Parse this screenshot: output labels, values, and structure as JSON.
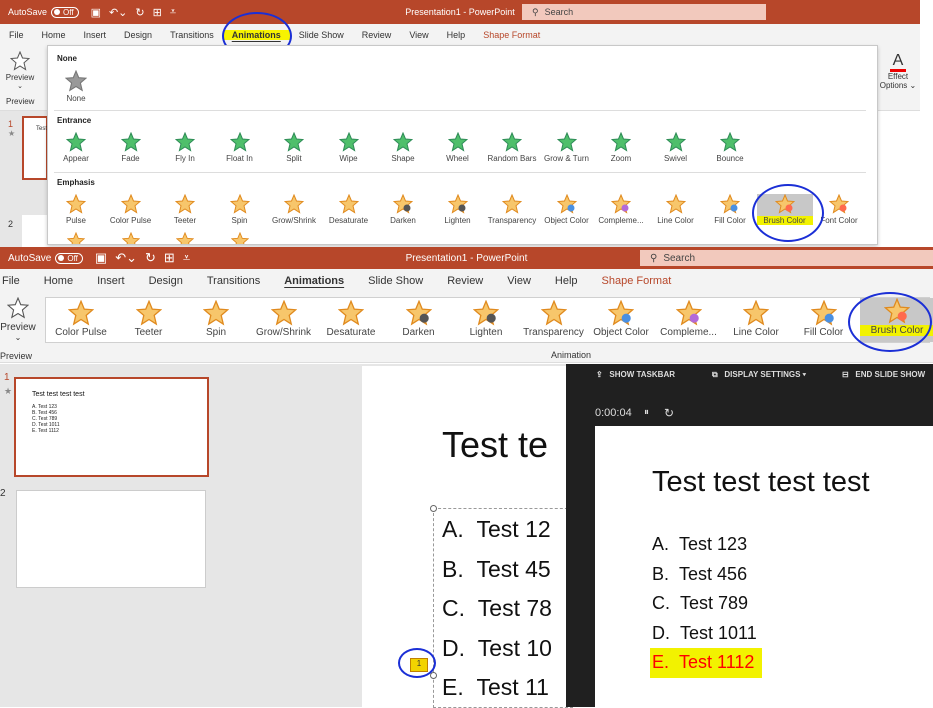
{
  "top": {
    "autosave_label": "AutoSave",
    "autosave_state": "Off",
    "title": "Presentation1 - PowerPoint",
    "search_placeholder": "Search",
    "menu": [
      "File",
      "Home",
      "Insert",
      "Design",
      "Transitions",
      "Animations",
      "Slide Show",
      "Review",
      "View",
      "Help",
      "Shape Format"
    ],
    "active_tab": "Animations",
    "preview_label": "Preview",
    "preview_group": "Preview",
    "effect_options_1": "Effect",
    "effect_options_2": "Options",
    "slide_numbers": [
      "1",
      "2"
    ],
    "thumb_title": "Test",
    "sections": {
      "none": "None",
      "entrance": "Entrance",
      "emphasis": "Emphasis"
    },
    "none_item": "None",
    "entrance_items": [
      "Appear",
      "Fade",
      "Fly In",
      "Float In",
      "Split",
      "Wipe",
      "Shape",
      "Wheel",
      "Random Bars",
      "Grow & Turn",
      "Zoom",
      "Swivel",
      "Bounce"
    ],
    "emphasis_items": [
      "Pulse",
      "Color Pulse",
      "Teeter",
      "Spin",
      "Grow/Shrink",
      "Desaturate",
      "Darken",
      "Lighten",
      "Transparency",
      "Object Color",
      "Compleme...",
      "Line Color",
      "Fill Color",
      "Brush Color",
      "Font Color"
    ]
  },
  "bottom": {
    "autosave_label": "AutoSave",
    "autosave_state": "Off",
    "title": "Presentation1 - PowerPoint",
    "search_placeholder": "Search",
    "menu": [
      "File",
      "Home",
      "Insert",
      "Design",
      "Transitions",
      "Animations",
      "Slide Show",
      "Review",
      "View",
      "Help",
      "Shape Format"
    ],
    "preview_label": "Preview",
    "preview_group": "Preview",
    "animation_group": "Animation",
    "items": [
      "Color Pulse",
      "Teeter",
      "Spin",
      "Grow/Shrink",
      "Desaturate",
      "Darken",
      "Lighten",
      "Transparency",
      "Object Color",
      "Compleme...",
      "Line Color",
      "Fill Color",
      "Brush Color"
    ],
    "selected": "Brush Color",
    "slide_numbers": [
      "1",
      "2"
    ],
    "thumb": {
      "title": "Test test test test",
      "lines": [
        "A.  Test 123",
        "B.  Test 456",
        "C.  Test 789",
        "D.  Test 1011",
        "E.  Test 1112"
      ]
    },
    "slide": {
      "title": "Test te",
      "letters": [
        "A.",
        "B.",
        "C.",
        "D.",
        "E."
      ],
      "texts": [
        "Test 12",
        "Test 45",
        "Test 78",
        "Test 10",
        "Test 11"
      ],
      "anim_tag": "1"
    },
    "presenter": {
      "show_taskbar": "SHOW TASKBAR",
      "display_settings": "DISPLAY SETTINGS ▾",
      "end_show": "END SLIDE SHOW",
      "timer": "0:00:04",
      "pause": "⏸",
      "reset": "↻",
      "title": "Test test test test",
      "letters": [
        "A.",
        "B.",
        "C.",
        "D.",
        "E."
      ],
      "texts": [
        "Test 123",
        "Test 456",
        "Test 789",
        "Test 1011",
        "Test 1112"
      ],
      "highlight_color": "#f2f200",
      "brush_color": "#ff0000"
    }
  }
}
